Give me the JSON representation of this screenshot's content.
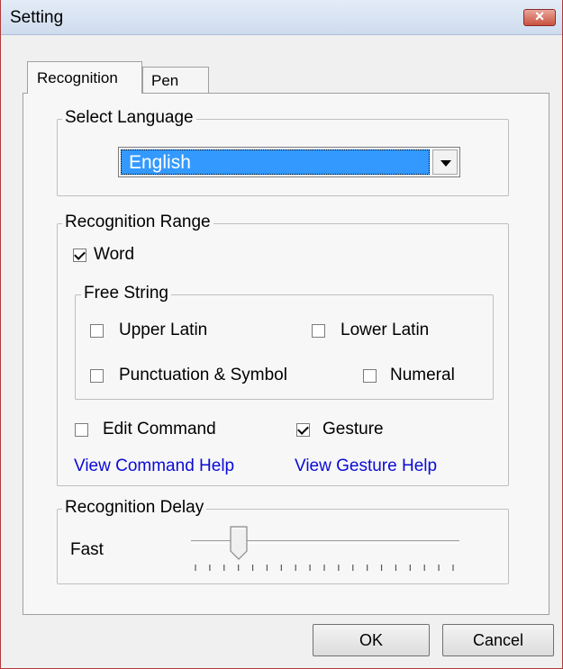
{
  "window": {
    "title": "Setting",
    "close_glyph": "×"
  },
  "tabs": [
    {
      "label": "Recognition",
      "active": true
    },
    {
      "label": "Pen",
      "active": false
    }
  ],
  "select_language": {
    "group_label": "Select Language",
    "value": "English"
  },
  "recognition_range": {
    "group_label": "Recognition Range",
    "word": {
      "label": "Word",
      "checked": true
    },
    "free_string": {
      "group_label": "Free String",
      "upper_latin": {
        "label": "Upper Latin",
        "checked": false
      },
      "lower_latin": {
        "label": "Lower Latin",
        "checked": false
      },
      "punctuation": {
        "label": "Punctuation & Symbol",
        "checked": false
      },
      "numeral": {
        "label": "Numeral",
        "checked": false
      }
    },
    "edit_command": {
      "label": "Edit Command",
      "checked": false
    },
    "gesture": {
      "label": "Gesture",
      "checked": true
    },
    "view_command_help": "View Command Help",
    "view_gesture_help": "View Gesture Help"
  },
  "recognition_delay": {
    "group_label": "Recognition Delay",
    "min_label": "Fast",
    "tick_count": 19,
    "value_index": 3
  },
  "buttons": {
    "ok": "OK",
    "cancel": "Cancel"
  },
  "colors": {
    "accent": "#3399ff",
    "link": "#0b0bd6",
    "close": "#c8513f"
  }
}
